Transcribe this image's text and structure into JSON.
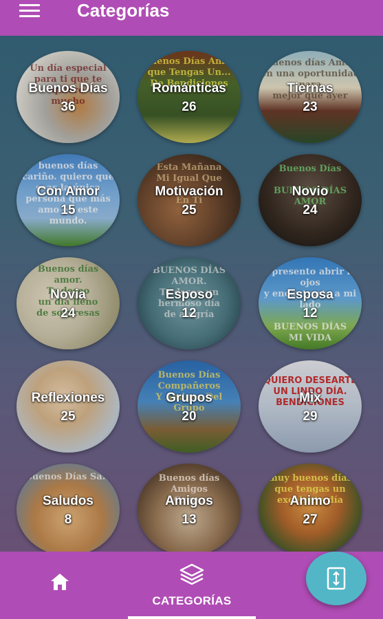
{
  "header": {
    "title": "Categorías",
    "menu_icon": "hamburger-menu-icon",
    "color": "#b04cb5"
  },
  "categories": [
    {
      "name": "Buenos Días",
      "count": "36",
      "deco": "Un día especial\npara ti que te quiero\nmucho"
    },
    {
      "name": "Románticas",
      "count": "26",
      "deco": "Buenos Días Amor\nque Tengas Un...\nDe Bendiciones"
    },
    {
      "name": "Tiernas",
      "count": "23",
      "deco": "Buenos días Amor\nen una oportunidad para\nmejor que ayer"
    },
    {
      "name": "Con Amor",
      "count": "15",
      "deco": "buenos días\ncariño. quiero que\nseas la única\npersona que más\namo en este\nmundo."
    },
    {
      "name": "Motivación",
      "count": "25",
      "deco": "Esta Mañana\nMi Igual Que\n\nEn Ti"
    },
    {
      "name": "Novio",
      "count": "24",
      "deco": "Buenos Días\n\nBUENOS DÍAS\nAMOR"
    },
    {
      "name": "Novia",
      "count": "24",
      "deco": "Buenos días\namor.\nTe deseo\nun día lleno\nde sorpresas"
    },
    {
      "name": "Esposo",
      "count": "12",
      "deco": "BUENOS DÍAS\nAMOR.\nTe deseo un\nhermoso día\nde alegría"
    },
    {
      "name": "Esposa",
      "count": "12",
      "deco": "te presento abrir los ojos\ny encontrarte a mi lado\n\nBUENOS DÍAS\nMI VIDA"
    },
    {
      "name": "Reflexiones",
      "count": "25",
      "deco": ""
    },
    {
      "name": "Grupos",
      "count": "20",
      "deco": "Buenos Días\nCompañeros\nY Amigos Del\nGrupo"
    },
    {
      "name": "Mix",
      "count": "29",
      "deco": "QUIERO DESEARTE\nUN LINDO DÍA.\nBENDICIONES"
    },
    {
      "name": "Saludos",
      "count": "8",
      "deco": "Buenos Días Sa..."
    },
    {
      "name": "Amigos",
      "count": "13",
      "deco": "Buenos días\nAmigos\nGrupo"
    },
    {
      "name": "Animo",
      "count": "27",
      "deco": "muy buenos días\nque tengas un\nexcelente día"
    }
  ],
  "bottom_nav": {
    "home_icon": "home-icon",
    "categories_icon": "layers-icon",
    "categories_label": "CATEGORÍAS",
    "fab_icon": "swap-vertical-icon",
    "fab_color": "#52b6c6"
  }
}
